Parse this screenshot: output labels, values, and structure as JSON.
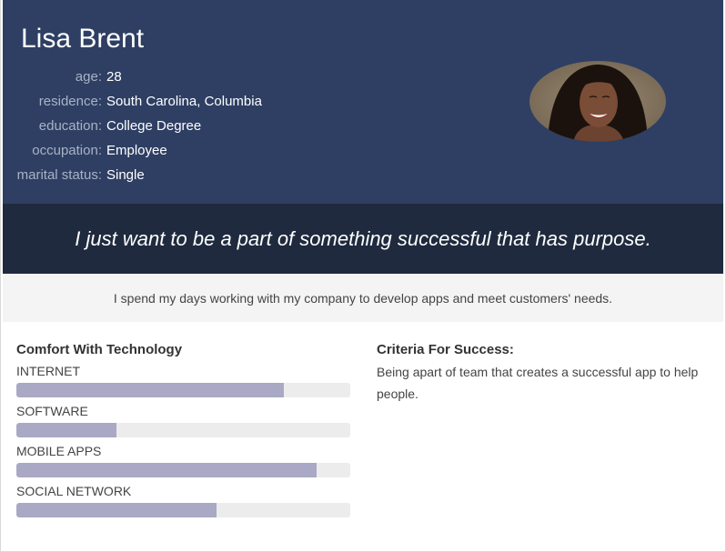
{
  "persona": {
    "name": "Lisa Brent",
    "details": [
      {
        "label": "age:",
        "value": "28"
      },
      {
        "label": "residence:",
        "value": "South Carolina, Columbia"
      },
      {
        "label": "education:",
        "value": "College Degree"
      },
      {
        "label": "occupation:",
        "value": "Employee"
      },
      {
        "label": "marital status:",
        "value": "Single"
      }
    ],
    "quote": "I just want to be a part of something successful that has purpose.",
    "summary": "I spend my days working with my company to develop apps and meet customers' needs."
  },
  "technology": {
    "title": "Comfort With Technology",
    "skills": [
      {
        "label": "INTERNET",
        "level": 0.8
      },
      {
        "label": "SOFTWARE",
        "level": 0.3
      },
      {
        "label": "MOBILE APPS",
        "level": 0.9
      },
      {
        "label": "SOCIAL NETWORK",
        "level": 0.6
      }
    ]
  },
  "criteria": {
    "title": "Criteria For Success:",
    "text": "Being apart of team that creates a successful app to help people."
  },
  "colors": {
    "header": "#2e3f63",
    "quote_band": "#1f2a3e",
    "bar_fill": "#a9a9c5",
    "bar_track": "#ececec"
  }
}
